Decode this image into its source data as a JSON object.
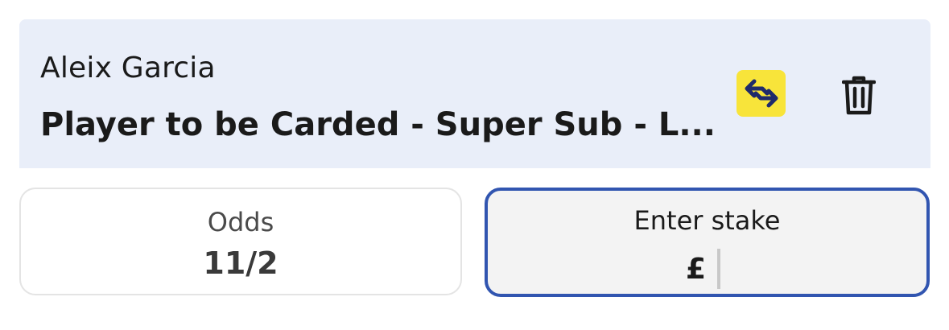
{
  "bet": {
    "selection": "Aleix Garcia",
    "market": "Player to be Carded - Super Sub - L..."
  },
  "actions": {
    "swap_icon": "swap-arrows-icon",
    "delete_icon": "trash-icon"
  },
  "odds": {
    "label": "Odds",
    "value": "11/2"
  },
  "stake": {
    "label": "Enter stake",
    "currency": "£",
    "value": ""
  },
  "colors": {
    "header_background": "#e9eef9",
    "swap_button": "#f8e43a",
    "swap_arrows": "#1f2a6b",
    "stake_border": "#3155b0",
    "stake_background": "#f3f3f3"
  }
}
